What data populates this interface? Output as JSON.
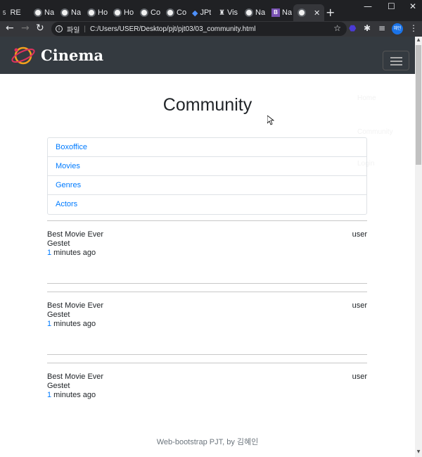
{
  "browser": {
    "tabs": [
      {
        "label": "RE"
      },
      {
        "label": "Na"
      },
      {
        "label": "Na"
      },
      {
        "label": "Ho"
      },
      {
        "label": "Ho"
      },
      {
        "label": "Co"
      },
      {
        "label": "Co"
      },
      {
        "label": "JPt"
      },
      {
        "label": "Vis"
      },
      {
        "label": "Na"
      },
      {
        "label": "Na"
      },
      {
        "label": ""
      }
    ],
    "address_prefix": "파일",
    "url": "C:/Users/USER/Desktop/pjt/pjt03/03_community.html",
    "profile_label": "혜인"
  },
  "navbar": {
    "brand": "Cinema",
    "ghost_items": [
      "Home",
      "Community",
      "Login"
    ]
  },
  "page": {
    "title": "Community",
    "categories": [
      "Boxoffice",
      "Movies",
      "Genres",
      "Actors"
    ],
    "posts": [
      {
        "title": "Best Movie Ever",
        "user": "user",
        "content": "Gestet",
        "time_num": "1",
        "time_text": " minutes ago"
      },
      {
        "title": "Best Movie Ever",
        "user": "user",
        "content": "Gestet",
        "time_num": "1",
        "time_text": " minutes ago"
      },
      {
        "title": "Best Movie Ever",
        "user": "user",
        "content": "Gestet",
        "time_num": "1",
        "time_text": " minutes ago"
      }
    ],
    "footer": "Web-bootstrap PJT, by 김혜인"
  },
  "colors": {
    "navbar_bg": "#343a40",
    "link": "#007bff",
    "text": "#212529",
    "muted": "#6c757d"
  }
}
